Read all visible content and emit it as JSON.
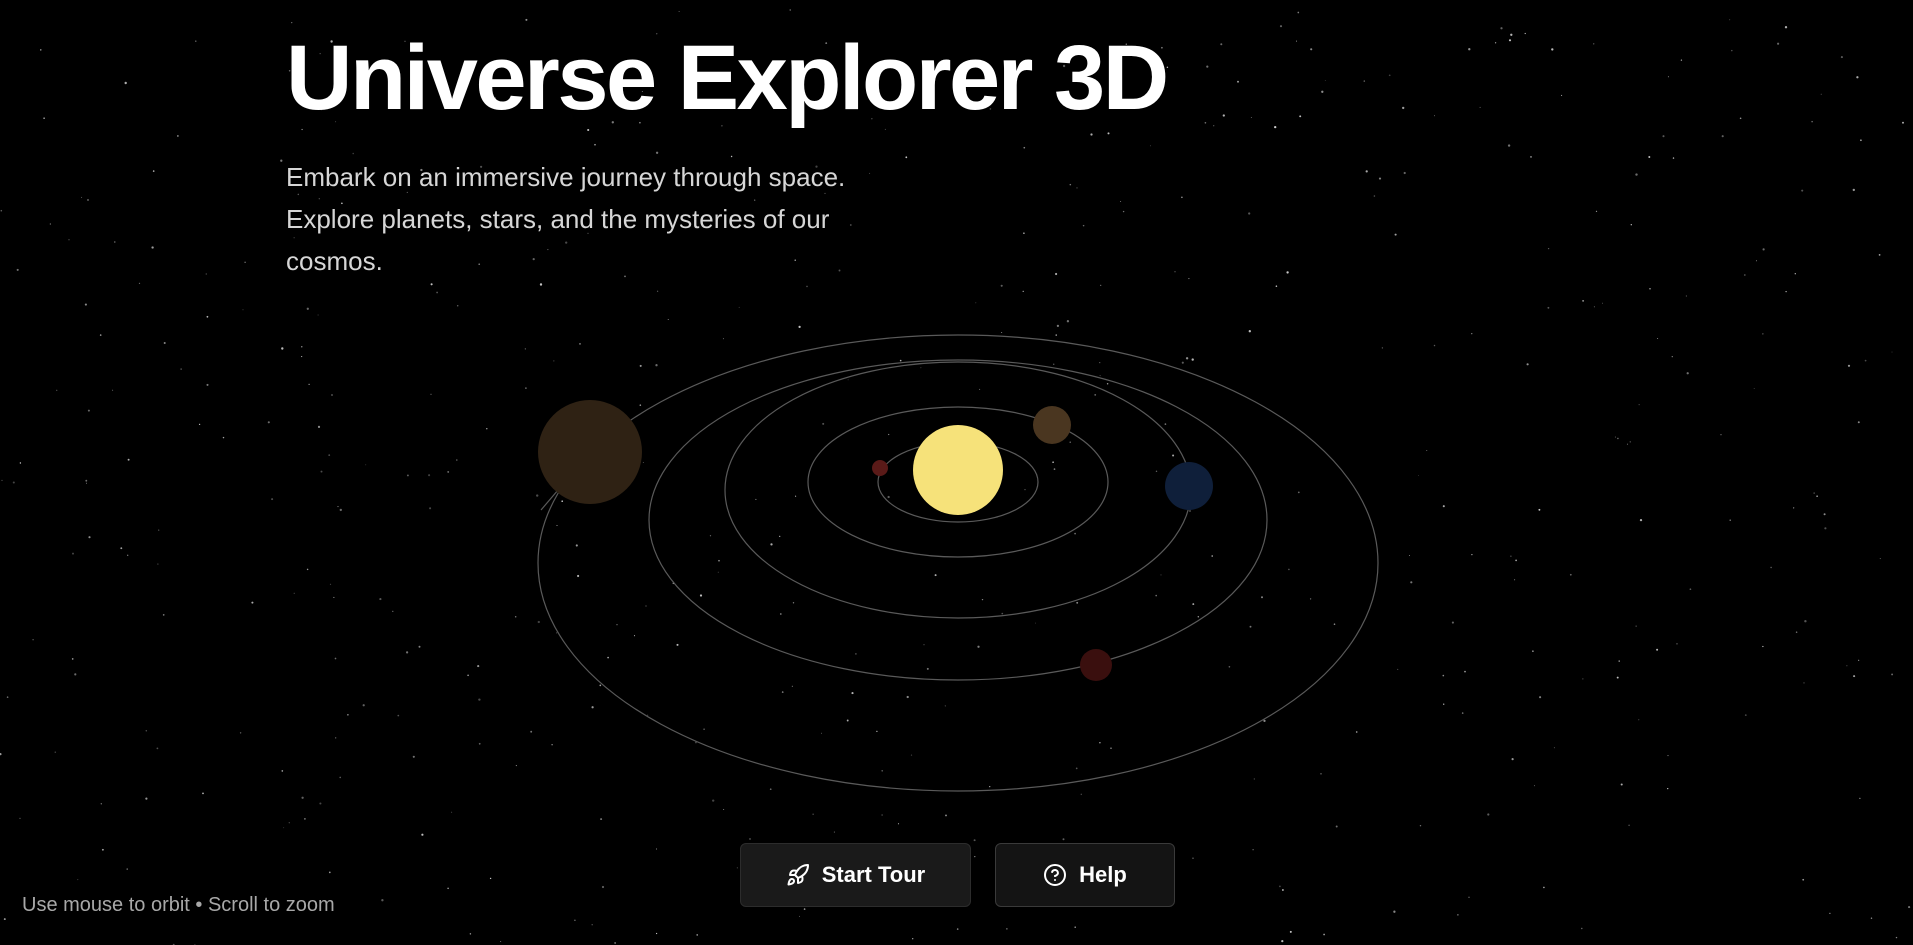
{
  "hero": {
    "title": "Universe Explorer 3D",
    "description": "Embark on an immersive journey through space. Explore planets, stars, and the mysteries of our cosmos."
  },
  "actions": {
    "start_tour": {
      "label": "Start Tour",
      "icon": "rocket-icon"
    },
    "help": {
      "label": "Help",
      "icon": "help-circle-icon"
    }
  },
  "controls_hint": "Use mouse to orbit • Scroll to zoom",
  "scene": {
    "background": "#000000",
    "sun_color": "#f6e27a",
    "orbit_color": "#5a5a5a",
    "planets": [
      {
        "name": "mercury",
        "color": "#5a1a18"
      },
      {
        "name": "venus",
        "color": "#4a3620"
      },
      {
        "name": "earth",
        "color": "#0f1f3a"
      },
      {
        "name": "mars",
        "color": "#3a0f0e"
      },
      {
        "name": "jupiter",
        "color": "#2f2214"
      }
    ]
  }
}
